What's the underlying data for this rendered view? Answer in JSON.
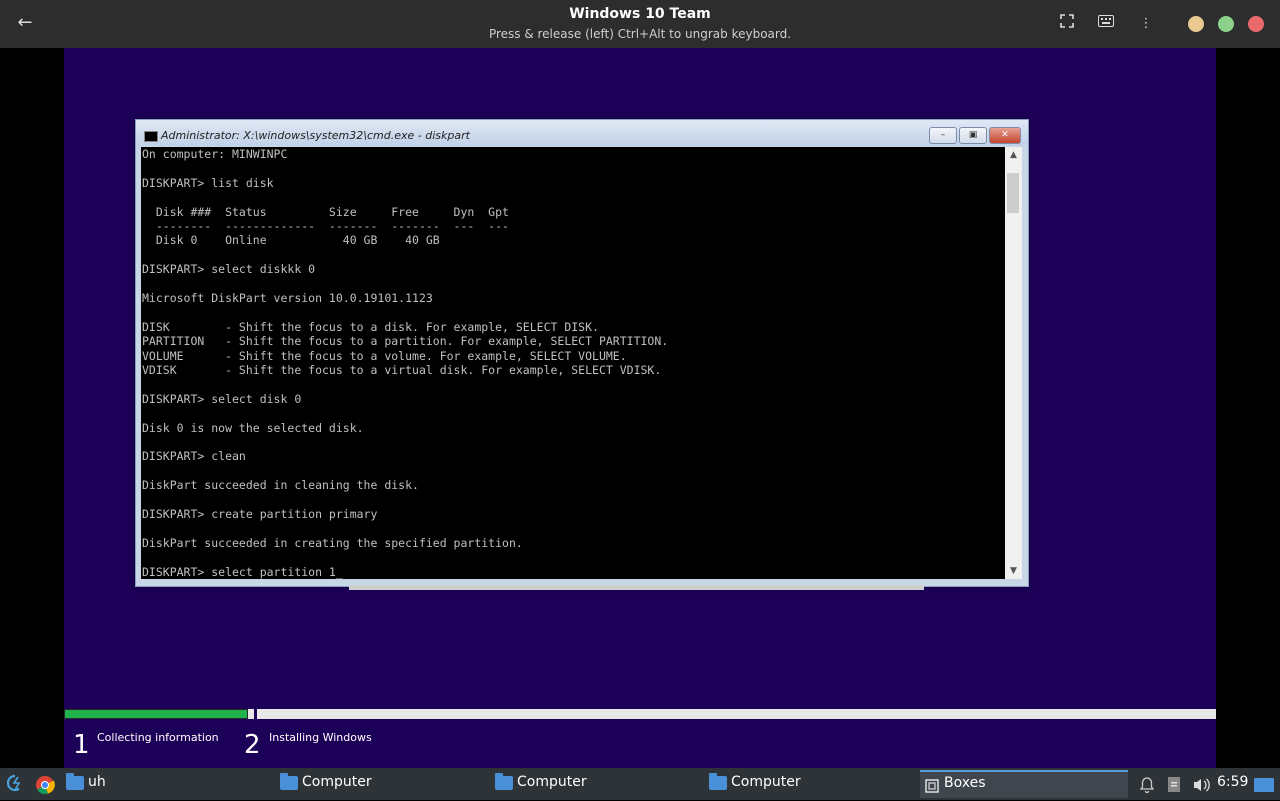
{
  "header": {
    "title": "Windows 10 Team",
    "subtitle": "Press & release (left) Ctrl+Alt to ungrab keyboard.",
    "icons": [
      "back-arrow-icon",
      "fullscreen-icon",
      "keyboard-icon",
      "menu-dots-icon"
    ],
    "dot_colors": {
      "minimize": "#e8c98f",
      "maximize": "#8bd18b",
      "close": "#e86a6a"
    }
  },
  "cmd_window": {
    "title": "Administrator: X:\\windows\\system32\\cmd.exe - diskpart",
    "console_lines": [
      "On computer: MINWINPC",
      "",
      "DISKPART> list disk",
      "",
      "  Disk ###  Status         Size     Free     Dyn  Gpt",
      "  --------  -------------  -------  -------  ---  ---",
      "  Disk 0    Online           40 GB    40 GB",
      "",
      "DISKPART> select diskkk 0",
      "",
      "Microsoft DiskPart version 10.0.19101.1123",
      "",
      "DISK        - Shift the focus to a disk. For example, SELECT DISK.",
      "PARTITION   - Shift the focus to a partition. For example, SELECT PARTITION.",
      "VOLUME      - Shift the focus to a volume. For example, SELECT VOLUME.",
      "VDISK       - Shift the focus to a virtual disk. For example, SELECT VDISK.",
      "",
      "DISKPART> select disk 0",
      "",
      "Disk 0 is now the selected disk.",
      "",
      "DISKPART> clean",
      "",
      "DiskPart succeeded in cleaning the disk.",
      "",
      "DISKPART> create partition primary",
      "",
      "DiskPart succeeded in creating the specified partition.",
      "",
      "DISKPART> select partition 1_"
    ]
  },
  "setup": {
    "progress": 0.16,
    "steps": [
      {
        "num": "1",
        "label": "Collecting information"
      },
      {
        "num": "2",
        "label": "Installing Windows"
      }
    ]
  },
  "taskbar": {
    "tasks": [
      {
        "label": "uh",
        "icon": "folder-icon"
      },
      {
        "label": "Computer",
        "icon": "folder-icon"
      },
      {
        "label": "Computer",
        "icon": "folder-icon"
      },
      {
        "label": "Computer",
        "icon": "folder-icon"
      },
      {
        "label": "Boxes",
        "icon": "boxes-icon"
      }
    ],
    "clock": "6:59",
    "tray_icons": [
      "bell-icon",
      "clipboard-icon",
      "volume-icon",
      "show-desktop-icon"
    ]
  }
}
